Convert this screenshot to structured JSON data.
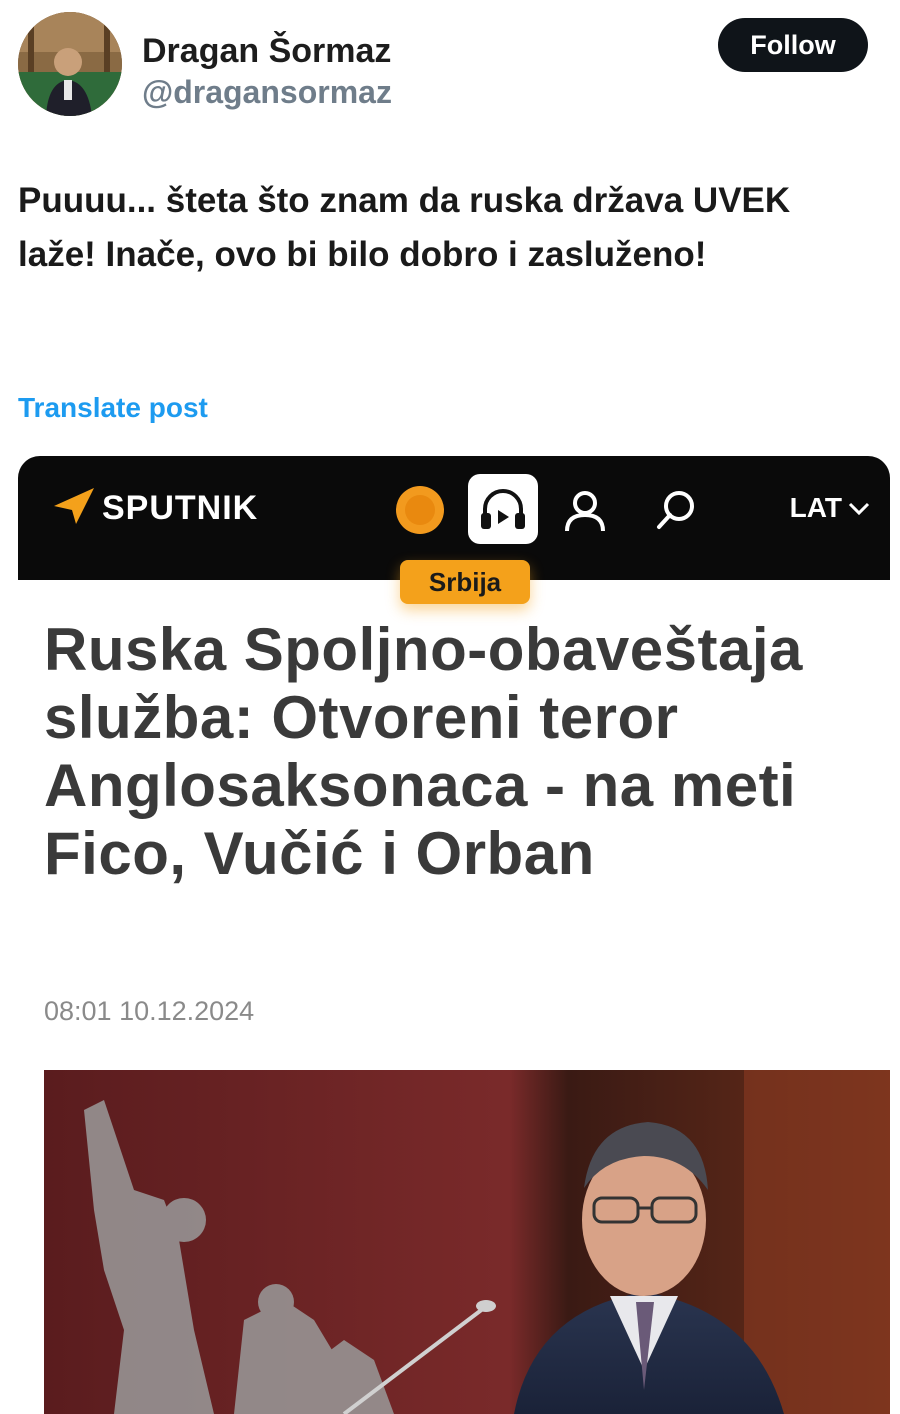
{
  "tweet": {
    "author": {
      "display_name": "Dragan Šormaz",
      "handle": "@dragansormaz"
    },
    "follow_label": "Follow",
    "text": "Puuuu... šteta što znam da ruska država UVEK laže! Inače, ovo bi bilo dobro i zasluženo!",
    "translate_label": "Translate post"
  },
  "article": {
    "site_name": "SPUTNIK",
    "language": "LAT",
    "section": "Srbija",
    "headline": "Ruska Spoljno-obaveštaja služba: Otvoreni teror Anglosaksonaca - na meti Fico, Vučić i Orban",
    "timestamp": "08:01 10.12.2024"
  },
  "colors": {
    "follow_bg": "#0f1419",
    "link": "#1d9bf0",
    "sputnik_bar": "#0a0a0a",
    "accent_orange": "#f4a11b",
    "headline_text": "#3a3a3a"
  },
  "icons": [
    "sputnik-logo-icon",
    "radio-dot-icon",
    "podcast-headphones-icon",
    "user-profile-icon",
    "search-icon",
    "chevron-down-icon"
  ]
}
